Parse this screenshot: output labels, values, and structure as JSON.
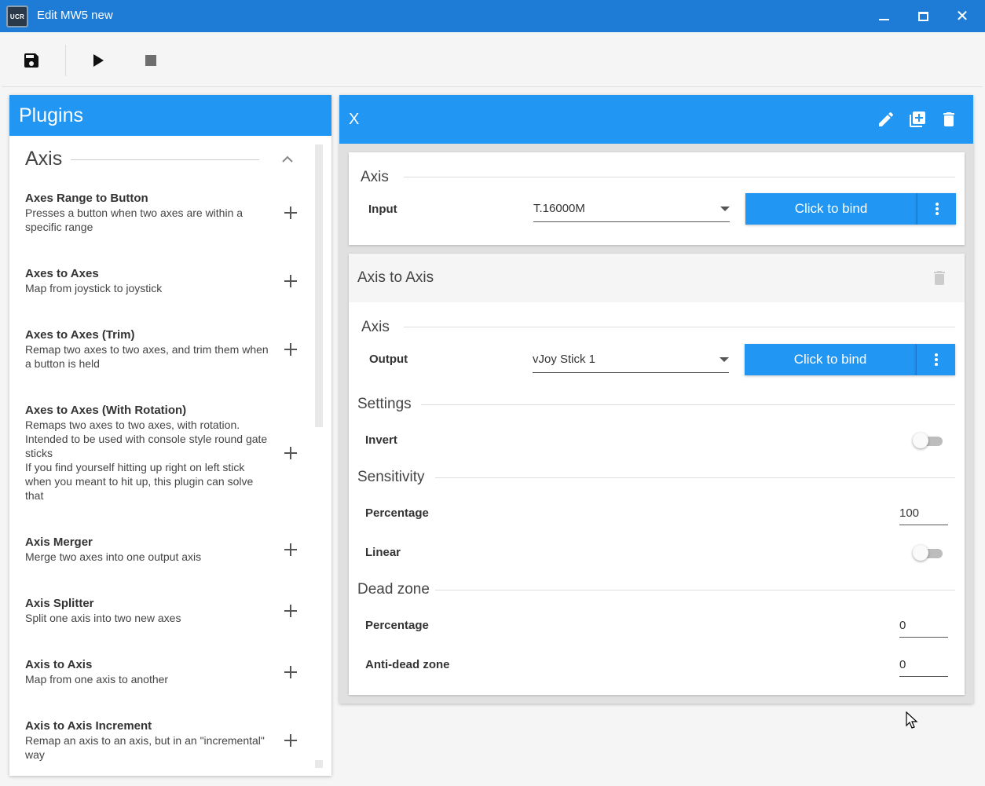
{
  "window": {
    "title": "Edit MW5 new",
    "app_icon_text": "UCR",
    "accent_color": "#2196f3",
    "titlebar_color": "#1e7bd6"
  },
  "toolbar": {
    "save_icon": "floppy-disk-icon",
    "play_icon": "play-icon",
    "stop_icon": "stop-icon"
  },
  "plugins": {
    "header": "Plugins",
    "section": "Axis",
    "items": [
      {
        "name": "Axes Range to Button",
        "desc": "Presses a button when two axes are within a specific range"
      },
      {
        "name": "Axes to Axes",
        "desc": "Map from joystick to joystick"
      },
      {
        "name": "Axes to Axes (Trim)",
        "desc": "Remap two axes to two axes, and trim them when a button is held"
      },
      {
        "name": "Axes to Axes (With Rotation)",
        "desc": "Remaps two axes to two axes, with rotation. Intended to be used with console style round gate sticks\nIf you find yourself hitting up right on left stick when you meant to hit up, this plugin can solve that"
      },
      {
        "name": "Axis Merger",
        "desc": "Merge two axes into one output axis"
      },
      {
        "name": "Axis Splitter",
        "desc": "Split one axis into two new axes"
      },
      {
        "name": "Axis to Axis",
        "desc": "Map from one axis to another"
      },
      {
        "name": "Axis to Axis Increment",
        "desc": "Remap an axis to an axis, but in an \"incremental\" way"
      }
    ]
  },
  "mapping": {
    "title": "X",
    "input_card": {
      "section": "Axis",
      "field_label": "Input",
      "device": "T.16000M",
      "bind_label": "Click to bind"
    },
    "plugin_card": {
      "title": "Axis to Axis",
      "axis_section": "Axis",
      "output_label": "Output",
      "output_device": "vJoy Stick 1",
      "bind_label": "Click to bind",
      "settings_section": "Settings",
      "invert_label": "Invert",
      "invert_on": false,
      "sensitivity_section": "Sensitivity",
      "sens_percentage_label": "Percentage",
      "sens_percentage_value": "100",
      "linear_label": "Linear",
      "linear_on": false,
      "deadzone_section": "Dead zone",
      "dz_percentage_label": "Percentage",
      "dz_percentage_value": "0",
      "anti_dz_label": "Anti-dead zone",
      "anti_dz_value": "0"
    }
  }
}
